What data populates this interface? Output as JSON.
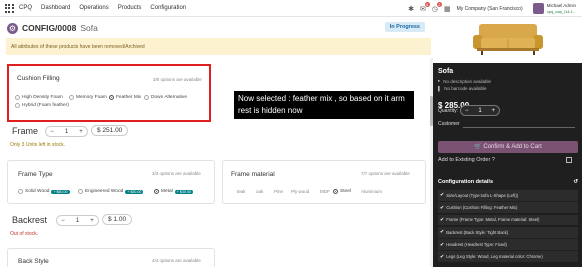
{
  "topbar": {
    "nav": [
      "CPQ",
      "Dashboard",
      "Operations",
      "Products",
      "Configuration"
    ],
    "chat_count": "6",
    "activity_count": "2",
    "company": "My Company (San Francisco)",
    "user_name": "Michael Admin",
    "user_db": "cpq_cap_l14-f..."
  },
  "control": {
    "record_id": "CONFIG/0008",
    "record_name": "Sofa",
    "status": "In Progress"
  },
  "alert": "All attributes of these products have been removed/Archived",
  "cushion": {
    "title": "Cushion Filling",
    "available": "3/5 options are available",
    "options": [
      "High Density Foam",
      "Memory Foam",
      "Feather Mix",
      "Down Alternative",
      "Hybrid (Foam feather)"
    ],
    "selected": "Feather Mix"
  },
  "callout": "Now selected : feather mix , so based on it arm rest is hidden now",
  "frame_qty": {
    "label": "Frame",
    "qty": "1",
    "price": "$ 251.00",
    "note": "Only 3 Units left in stock."
  },
  "frame_type": {
    "title": "Frame Type",
    "available": "3/3 options are available",
    "options": [
      {
        "label": "Solid Wood",
        "price": "+ $50.00"
      },
      {
        "label": "Engineered Wood",
        "price": "+ $30.00"
      },
      {
        "label": "Metal",
        "price": "+ $30.00"
      }
    ],
    "selected": "Metal"
  },
  "frame_material": {
    "title": "Frame material",
    "available": "7/7 options are available",
    "options": [
      "teak",
      "oak",
      "Pine",
      "Ply wood",
      "MDF",
      "Steel",
      "Aluminium"
    ],
    "selected": "Steel"
  },
  "backrest_qty": {
    "label": "Backrest",
    "qty": "1",
    "price": "$ 1.00",
    "note": "Out of stock."
  },
  "back_style": {
    "title": "Back Style",
    "available": "4/4 options are available"
  },
  "panel": {
    "product_name": "Sofa",
    "no_description": "No description available",
    "no_barcode": "No barcode available",
    "price": "$ 285.00",
    "quantity_label": "Quantity:",
    "quantity": "1",
    "customer_label": "Customer",
    "add_to_cart": "Confirm & Add to Cart",
    "existing_order": "Add to Existing Order ?",
    "config_details": "Configuration details",
    "details": [
      "Size/Layout (Type:sofa L-Shape (Left))",
      "Cushion (Cushion Filling: Feather Mix)",
      "Frame (Frame Type: Metal, Frame material: Steel)",
      "Backrest (Back Style: Tight Back)",
      "Headrest (Headrest Type: Fixed)",
      "Legs (Leg Style: Wood, Leg material color: Chrome)"
    ]
  },
  "colors": {
    "accent": "#7b5a8c",
    "status_bg": "#d8eaf5",
    "highlight_border": "#e02020",
    "panel_bg": "#1f1f1f",
    "price_badge": "#017e84"
  }
}
